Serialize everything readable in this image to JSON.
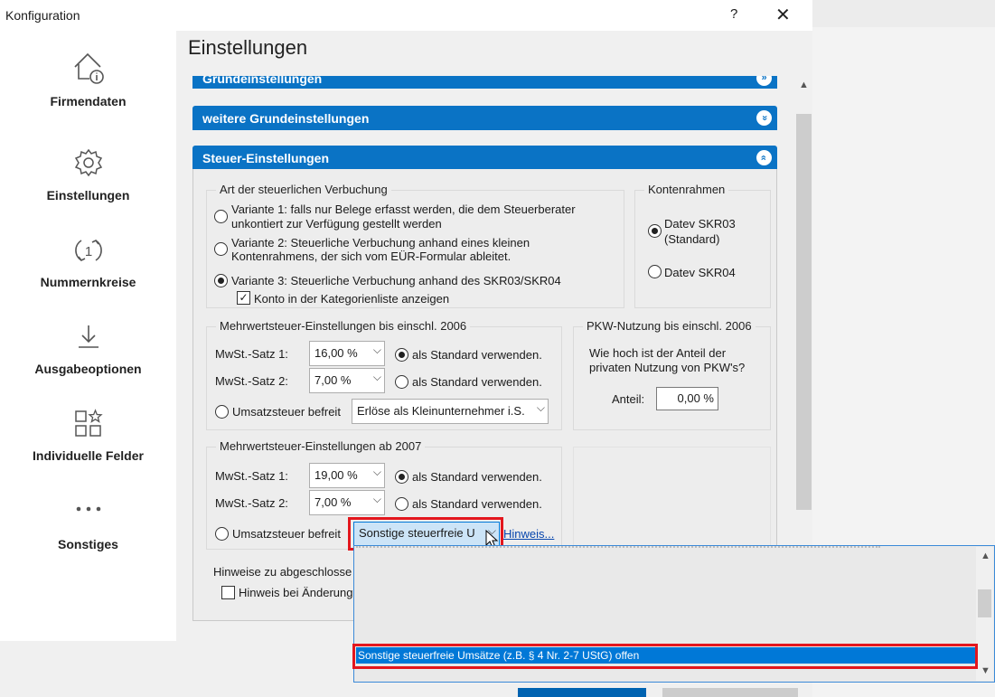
{
  "window": {
    "title": "Konfiguration",
    "help": "?",
    "close": "✕"
  },
  "sidebar": {
    "items": [
      {
        "label": "Firmendaten"
      },
      {
        "label": "Einstellungen"
      },
      {
        "label": "Nummernkreise"
      },
      {
        "label": "Ausgabeoptionen"
      },
      {
        "label": "Individuelle Felder"
      },
      {
        "label": "Sonstiges"
      }
    ]
  },
  "page": {
    "title": "Einstellungen"
  },
  "sections": {
    "grund": "Grundeinstellungen",
    "weitere": "weitere Grundeinstellungen",
    "steuer": "Steuer-Einstellungen"
  },
  "verbuchung": {
    "title": "Art der steuerlichen Verbuchung",
    "v1_line1": "Variante 1: falls nur Belege erfasst werden, die dem Steuerberater",
    "v1_line2": "unkontiert zur Verfügung gestellt werden",
    "v2_line1": "Variante 2: Steuerliche Verbuchung anhand eines kleinen",
    "v2_line2": "Kontenrahmens, der sich vom EÜR-Formular ableitet.",
    "v3": "Variante 3: Steuerliche Verbuchung anhand des SKR03/SKR04",
    "konto_check": "Konto in der Kategorienliste anzeigen",
    "selected": "Variante 3"
  },
  "kontenrahmen": {
    "title": "Kontenrahmen",
    "skr03_line1": "Datev SKR03",
    "skr03_line2": "(Standard)",
    "skr04": "Datev SKR04",
    "selected": "Datev SKR03"
  },
  "mwst2006": {
    "title": "Mehrwertsteuer-Einstellungen bis einschl. 2006",
    "satz1_label": "MwSt.-Satz 1:",
    "satz1_value": "16,00 %",
    "satz2_label": "MwSt.-Satz 2:",
    "satz2_value": "7,00 %",
    "standard_label": "als Standard verwenden.",
    "befreit_label": "Umsatzsteuer befreit",
    "befreit_value": "Erlöse als Kleinunternehmer i.S.",
    "standard_selected": "satz1"
  },
  "pkw": {
    "title": "PKW-Nutzung bis einschl. 2006",
    "question_line1": "Wie hoch ist der Anteil der",
    "question_line2": "privaten Nutzung von PKW's?",
    "anteil_label": "Anteil:",
    "anteil_value": "0,00 %"
  },
  "mwst2007": {
    "title": "Mehrwertsteuer-Einstellungen ab 2007",
    "satz1_label": "MwSt.-Satz 1:",
    "satz1_value": "19,00 %",
    "satz2_label": "MwSt.-Satz 2:",
    "satz2_value": "7,00 %",
    "standard_label": "als Standard verwenden.",
    "befreit_label": "Umsatzsteuer befreit",
    "befreit_value": "Sonstige steuerfreie U",
    "hinweis_link": "Hinweis...",
    "standard_selected": "satz1"
  },
  "hinweise": {
    "title": "Hinweise zu abgeschlosse",
    "check_label": "Hinweis bei Änderung"
  },
  "dropdown": {
    "selected_option": "Sonstige steuerfreie Umsätze (z.B. § 4 Nr. 2-7 UStG) offen"
  },
  "colors": {
    "accent": "#0a73c5",
    "highlight": "#e3161d",
    "selection": "#0078d7"
  },
  "icons": [
    "home-info-icon",
    "gear-icon",
    "refresh-number-icon",
    "download-icon",
    "widgets-icon",
    "more-icon"
  ]
}
